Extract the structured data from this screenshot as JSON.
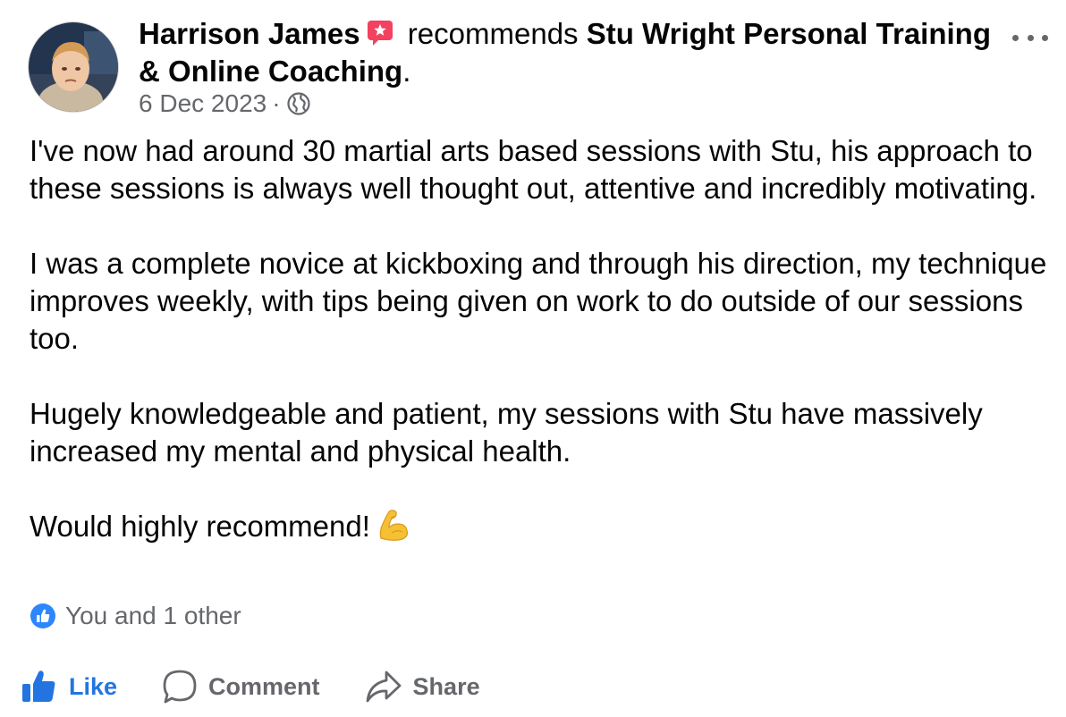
{
  "post": {
    "author": "Harrison James",
    "verb": " recommends ",
    "page_name": "Stu Wright Personal Training & Online Coaching",
    "trailing": ".",
    "date": "6 Dec 2023",
    "separator": "·",
    "audience_icon": "globe-icon"
  },
  "body": {
    "paragraphs": [
      "I've now had around 30 martial arts based sessions with Stu, his approach to these sessions is always well thought out, attentive and incredibly motivating.",
      "I was a complete novice at kickboxing and through his direction, my technique improves weekly, with tips being given on work to do outside of our sessions too.",
      "Hugely knowledgeable and patient, my sessions with Stu have massively increased my mental and physical health.",
      "Would highly recommend!"
    ],
    "emoji": "flexed-biceps-icon"
  },
  "reactions": {
    "summary": "You and 1 other",
    "icon": "like-bubble-icon"
  },
  "actions": {
    "like_label": "Like",
    "comment_label": "Comment",
    "share_label": "Share"
  },
  "colors": {
    "accent": "#2374e1",
    "muted": "#65676b",
    "text": "#050505",
    "recommend_badge": "#f3425f"
  }
}
